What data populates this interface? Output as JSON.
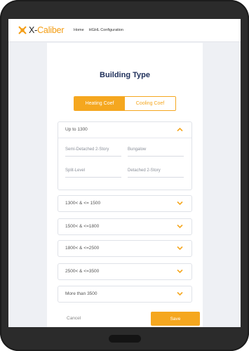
{
  "nav": {
    "logo_prefix": "X-",
    "logo_main": "Caliber",
    "links": [
      "Home",
      "HGHL Configuration"
    ]
  },
  "page": {
    "title": "Building Type",
    "tabs": [
      {
        "label": "Heating Coef",
        "active": true
      },
      {
        "label": "Cooling Coef",
        "active": false
      }
    ],
    "sections": [
      {
        "label": "Up to 1300",
        "expanded": true,
        "fields": [
          "Semi-Detached 2-Story",
          "Bungalow",
          "Split-Level",
          "Detached 2-Story"
        ]
      },
      {
        "label": "1300< & <= 1500",
        "expanded": false
      },
      {
        "label": "1500< & <=1800",
        "expanded": false
      },
      {
        "label": "1800< & <=2500",
        "expanded": false
      },
      {
        "label": "2500< & <=3500",
        "expanded": false
      },
      {
        "label": "More than 3500",
        "expanded": false
      }
    ],
    "cancel_label": "Cancel",
    "save_label": "Save"
  },
  "colors": {
    "accent": "#f5a71f",
    "title": "#1d2e59"
  },
  "icons": {
    "expanded": "chevron-up-icon",
    "collapsed": "chevron-down-icon",
    "logo": "xcaliber-logo-icon"
  }
}
